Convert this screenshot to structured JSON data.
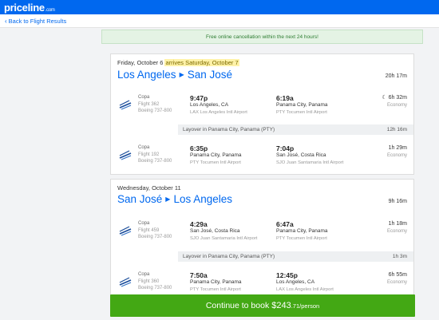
{
  "header": {
    "logo": "priceline",
    "logo_suffix": ".com"
  },
  "nav": {
    "back_label": "Back to Flight Results"
  },
  "notice": "Free online cancellation within the next 24 hours!",
  "outbound": {
    "date": "Friday, October 6",
    "arrives_note": "arrives Saturday, October 7",
    "origin": "Los Angeles",
    "destination": "San José",
    "total_duration": "20h 17m",
    "segments": [
      {
        "airline": "Copa",
        "flight": "Flight 362",
        "aircraft": "Boeing 737-800",
        "dep_time": "9:47p",
        "dep_city": "Los Angeles, CA",
        "dep_airport": "LAX Los Angeles Intl Airport",
        "arr_time": "6:19a",
        "arr_city": "Panama City, Panama",
        "arr_airport": "PTY Tocumen Intl Airport",
        "duration": "6h 32m",
        "cabin": "Economy"
      },
      {
        "airline": "Copa",
        "flight": "Flight 192",
        "aircraft": "Boeing 737-800",
        "dep_time": "6:35p",
        "dep_city": "Panama City, Panama",
        "dep_airport": "PTY Tocumen Intl Airport",
        "arr_time": "7:04p",
        "arr_city": "San José, Costa Rica",
        "arr_airport": "SJO Juan Santamaria Intl Airport",
        "duration": "1h 29m",
        "cabin": "Economy"
      }
    ],
    "layover": {
      "label": "Layover in Panama City, Panama (PTY)",
      "duration": "12h 16m"
    }
  },
  "return": {
    "date": "Wednesday, October 11",
    "origin": "San José",
    "destination": "Los Angeles",
    "total_duration": "9h 16m",
    "segments": [
      {
        "airline": "Copa",
        "flight": "Flight 459",
        "aircraft": "Boeing 737-800",
        "dep_time": "4:29a",
        "dep_city": "San José, Costa Rica",
        "dep_airport": "SJO Juan Santamaria Intl Airport",
        "arr_time": "6:47a",
        "arr_city": "Panama City, Panama",
        "arr_airport": "PTY Tocumen Intl Airport",
        "duration": "1h 18m",
        "cabin": "Economy"
      },
      {
        "airline": "Copa",
        "flight": "Flight 360",
        "aircraft": "Boeing 737-800",
        "dep_time": "7:50a",
        "dep_city": "Panama City, Panama",
        "dep_airport": "PTY Tocumen Intl Airport",
        "arr_time": "12:45p",
        "arr_city": "Los Angeles, CA",
        "arr_airport": "LAX Los Angeles Intl Airport",
        "duration": "6h 55m",
        "cabin": "Economy"
      }
    ],
    "layover": {
      "label": "Layover in Panama City, Panama (PTY)",
      "duration": "1h 3m"
    }
  },
  "cta": {
    "label": "Continue to book",
    "price_main": "$243",
    "price_cents": ".71",
    "per": "/person"
  },
  "colors": {
    "brand": "#0068ef",
    "cta": "#43a814",
    "notice_bg": "#e4f3e4",
    "highlight": "#fff2a8"
  },
  "icons": {
    "airline_logo": "copa-logo-icon",
    "overnight": "moon-icon",
    "route_arrow": "triangle-right-icon",
    "back": "chevron-left-icon"
  }
}
